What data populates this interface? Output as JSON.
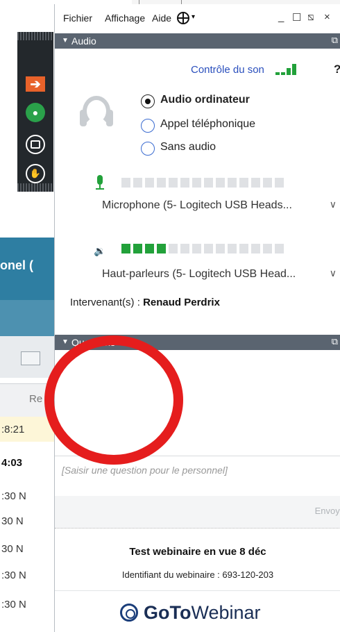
{
  "background_app": {
    "toolbar_icons": [
      "arrow-right-icon",
      "microphone-icon",
      "window-icon",
      "hand-icon"
    ],
    "banner_text": "onel (",
    "tab_text": "Re",
    "list_times": [
      ":8:21",
      "4:03",
      ":30 N",
      "30 N",
      "30 N",
      ":30 N",
      ":30 N"
    ]
  },
  "menu": {
    "items": [
      "Fichier",
      "Affichage",
      "Aide"
    ],
    "window_controls": [
      "_",
      "☐",
      "⧅",
      "×"
    ]
  },
  "audio": {
    "section_label": "Audio",
    "control_link": "Contrôle du son",
    "signal_color": "#22a13a",
    "options": [
      {
        "label": "Audio ordinateur",
        "selected": true
      },
      {
        "label": "Appel téléphonique",
        "selected": false
      },
      {
        "label": "Sans audio",
        "selected": false
      }
    ],
    "mic_level_segments": {
      "on": 0,
      "total": 14
    },
    "microphone_device": "Microphone (5- Logitech USB Heads...",
    "speaker_level_segments": {
      "on": 4,
      "total": 14
    },
    "speaker_device": "Haut-parleurs (5- Logitech USB Head...",
    "speakers_label": "Intervenant(s) :",
    "speakers_name": "Renaud Perdrix"
  },
  "questions": {
    "section_label": "Questions",
    "input_placeholder": "[Saisir une question pour le personnel]",
    "send_label": "Envoye"
  },
  "webinar": {
    "title": "Test webinaire en vue 8 déc",
    "id_text": "Identifiant du webinaire : 693-120-203"
  },
  "brand": {
    "goto": "GoTo",
    "webinar": "Webinar",
    "color": "#1a2e55"
  },
  "annotation": {
    "color": "#e51d1d"
  }
}
